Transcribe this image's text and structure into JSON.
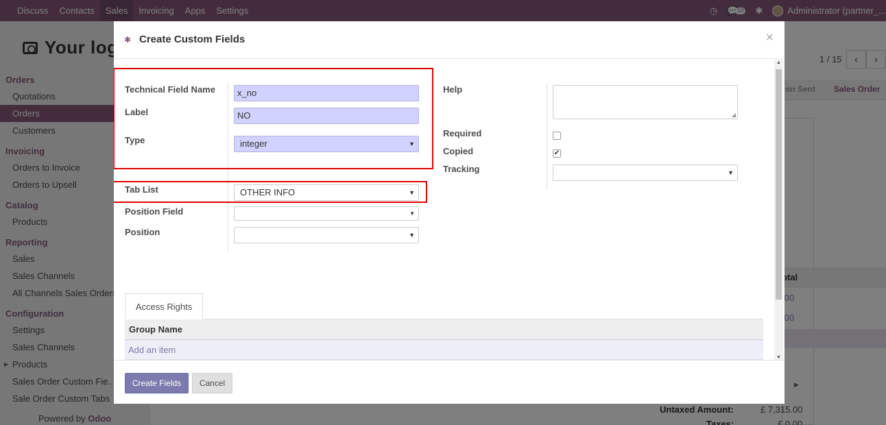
{
  "navbar": {
    "menu": [
      "Discuss",
      "Contacts",
      "Sales",
      "Invoicing",
      "Apps",
      "Settings"
    ],
    "active_menu": "Sales",
    "chat_badge": "10",
    "user": "Administrator (partner_..."
  },
  "sidebar": {
    "logo_text": "Your log",
    "sections": {
      "orders": "Orders",
      "invoicing": "Invoicing",
      "catalog": "Catalog",
      "reporting": "Reporting",
      "configuration": "Configuration"
    },
    "items": {
      "quotations": "Quotations",
      "orders": "Orders",
      "customers": "Customers",
      "orders_to_invoice": "Orders to Invoice",
      "orders_to_upsell": "Orders to Upsell",
      "products": "Products",
      "sales": "Sales",
      "sales_channels": "Sales Channels",
      "all_channels": "All Channels Sales Orders",
      "settings": "Settings",
      "cfg_sales_channels": "Sales Channels",
      "cfg_products": "Products",
      "custom_fields": "Sales Order Custom Fie...",
      "custom_tabs": "Sale Order Custom Tabs"
    },
    "powered_by": "Powered by",
    "powered_brand": "Odoo"
  },
  "background": {
    "pager": "1 / 15",
    "status_sent": "on Sent",
    "status_order": "Sales Order",
    "col_total": "otal",
    "val_1": ".00",
    "val_2": ".00",
    "untaxed_label": "Untaxed Amount:",
    "untaxed_value": "£ 7,315.00",
    "taxes_label": "Taxes:",
    "taxes_value": "£ 0.00"
  },
  "modal": {
    "title": "Create Custom Fields",
    "close": "×",
    "fields": {
      "technical_name_label": "Technical Field Name",
      "technical_name_value": "x_no",
      "label_label": "Label",
      "label_value": "NO",
      "type_label": "Type",
      "type_value": "integer",
      "tab_list_label": "Tab List",
      "tab_list_value": "OTHER INFO",
      "position_field_label": "Position Field",
      "position_field_value": "",
      "position_label": "Position",
      "position_value": "",
      "help_label": "Help",
      "required_label": "Required",
      "required_checked": false,
      "copied_label": "Copied",
      "copied_checked": true,
      "tracking_label": "Tracking",
      "tracking_value": ""
    },
    "tab": "Access Rights",
    "table": {
      "header": "Group Name",
      "add_item": "Add an item"
    },
    "buttons": {
      "create": "Create Fields",
      "cancel": "Cancel"
    }
  }
}
